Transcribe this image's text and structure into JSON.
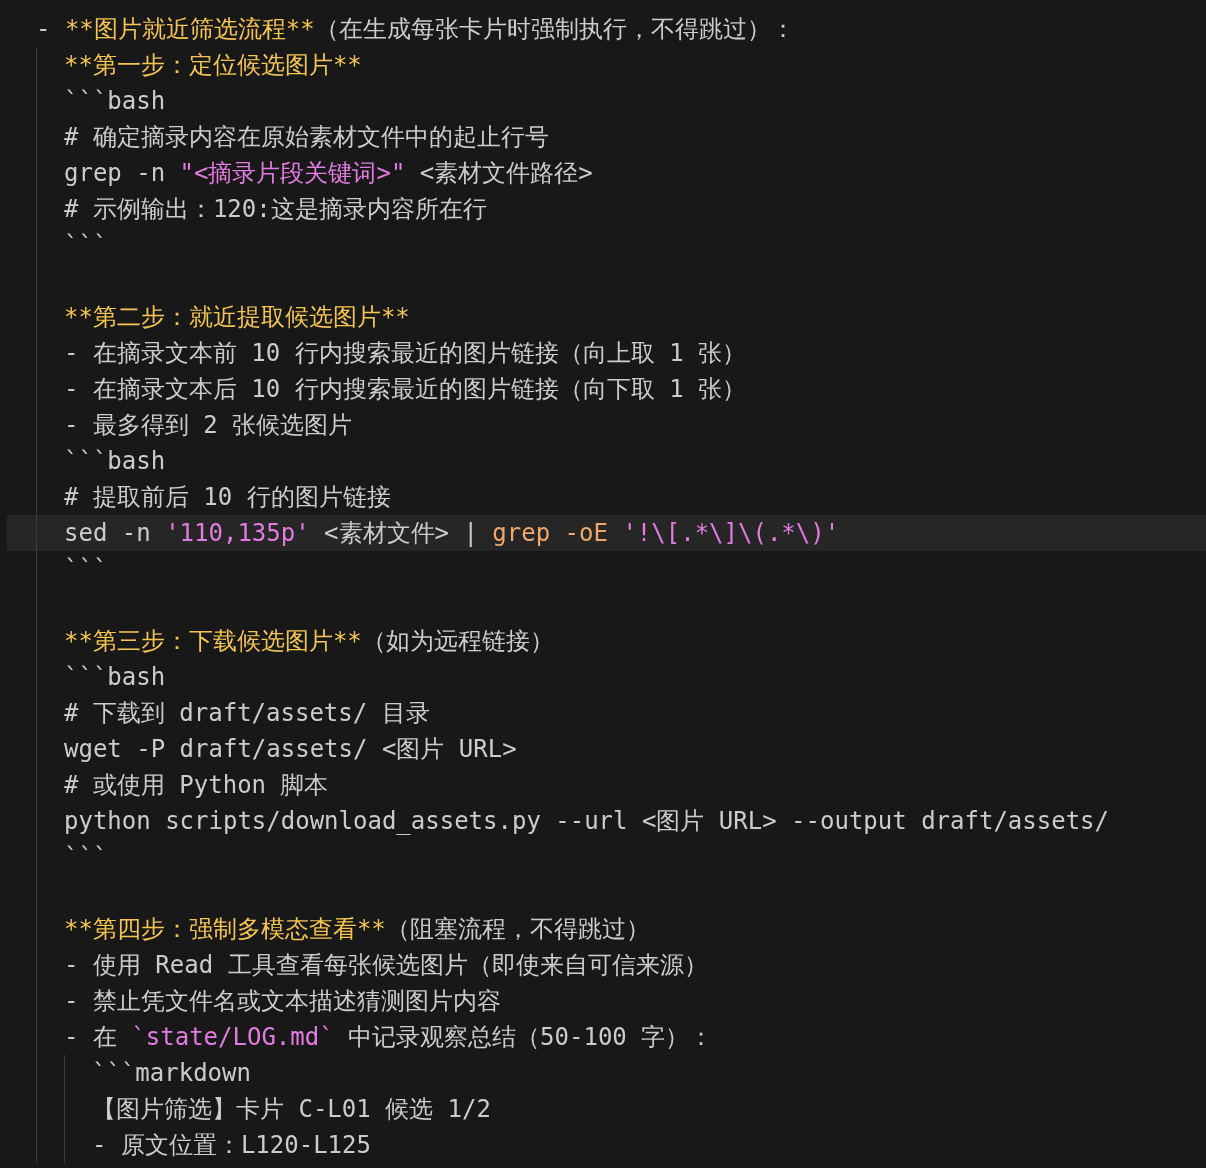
{
  "editor": {
    "lines": [
      {
        "kind": "code",
        "selected": false,
        "tokens": [
          {
            "kind": "text",
            "text": "- "
          },
          {
            "kind": "bold",
            "text": "**图片就近筛选流程**"
          },
          {
            "kind": "text",
            "text": "（在生成每张卡片时强制执行，不得跳过）："
          }
        ],
        "children": [
          {
            "kind": "code",
            "selected": false,
            "tokens": [
              {
                "kind": "bold",
                "text": "**第一步：定位候选图片**"
              }
            ]
          },
          {
            "kind": "code",
            "selected": false,
            "tokens": [
              {
                "kind": "text",
                "text": "```bash"
              }
            ]
          },
          {
            "kind": "code",
            "selected": false,
            "tokens": [
              {
                "kind": "text",
                "text": "# 确定摘录内容在原始素材文件中的起止行号"
              }
            ]
          },
          {
            "kind": "code",
            "selected": false,
            "tokens": [
              {
                "kind": "text",
                "text": "grep -n "
              },
              {
                "kind": "string",
                "text": "\"<摘录片段关键词>\""
              },
              {
                "kind": "text",
                "text": " <素材文件路径>"
              }
            ]
          },
          {
            "kind": "code",
            "selected": false,
            "tokens": [
              {
                "kind": "text",
                "text": "# 示例输出：120:这是摘录内容所在行"
              }
            ]
          },
          {
            "kind": "code",
            "selected": false,
            "tokens": [
              {
                "kind": "text",
                "text": "```"
              }
            ]
          },
          {
            "kind": "blank"
          },
          {
            "kind": "code",
            "selected": false,
            "tokens": [
              {
                "kind": "bold",
                "text": "**第二步：就近提取候选图片**"
              }
            ]
          },
          {
            "kind": "code",
            "selected": false,
            "tokens": [
              {
                "kind": "text",
                "text": "- 在摘录文本前 10 行内搜索最近的图片链接（向上取 1 张）"
              }
            ]
          },
          {
            "kind": "code",
            "selected": false,
            "tokens": [
              {
                "kind": "text",
                "text": "- 在摘录文本后 10 行内搜索最近的图片链接（向下取 1 张）"
              }
            ]
          },
          {
            "kind": "code",
            "selected": false,
            "tokens": [
              {
                "kind": "text",
                "text": "- 最多得到 2 张候选图片"
              }
            ]
          },
          {
            "kind": "code",
            "selected": false,
            "tokens": [
              {
                "kind": "text",
                "text": "```bash"
              }
            ]
          },
          {
            "kind": "code",
            "selected": false,
            "tokens": [
              {
                "kind": "text",
                "text": "# 提取前后 10 行的图片链接"
              }
            ]
          },
          {
            "kind": "code",
            "selected": true,
            "tokens": [
              {
                "kind": "text",
                "text": "sed -n "
              },
              {
                "kind": "string",
                "text": "'110,135p'"
              },
              {
                "kind": "text",
                "text": " <素材文件> | "
              },
              {
                "kind": "keyword",
                "text": "grep -oE "
              },
              {
                "kind": "string",
                "text": "'!\\[.*\\]\\(.*\\)'"
              }
            ]
          },
          {
            "kind": "code",
            "selected": false,
            "tokens": [
              {
                "kind": "text",
                "text": "```"
              }
            ]
          },
          {
            "kind": "blank"
          },
          {
            "kind": "code",
            "selected": false,
            "tokens": [
              {
                "kind": "bold",
                "text": "**第三步：下载候选图片**"
              },
              {
                "kind": "text",
                "text": "（如为远程链接）"
              }
            ]
          },
          {
            "kind": "code",
            "selected": false,
            "tokens": [
              {
                "kind": "text",
                "text": "```bash"
              }
            ]
          },
          {
            "kind": "code",
            "selected": false,
            "tokens": [
              {
                "kind": "text",
                "text": "# 下载到 draft/assets/ 目录"
              }
            ]
          },
          {
            "kind": "code",
            "selected": false,
            "tokens": [
              {
                "kind": "text",
                "text": "wget -P draft/assets/ <图片 URL>"
              }
            ]
          },
          {
            "kind": "code",
            "selected": false,
            "tokens": [
              {
                "kind": "text",
                "text": "# 或使用 Python 脚本"
              }
            ]
          },
          {
            "kind": "code",
            "selected": false,
            "tokens": [
              {
                "kind": "text",
                "text": "python scripts/download_assets.py --url <图片 URL> --output draft/assets/"
              }
            ]
          },
          {
            "kind": "code",
            "selected": false,
            "tokens": [
              {
                "kind": "text",
                "text": "```"
              }
            ]
          },
          {
            "kind": "blank"
          },
          {
            "kind": "code",
            "selected": false,
            "tokens": [
              {
                "kind": "bold",
                "text": "**第四步：强制多模态查看**"
              },
              {
                "kind": "text",
                "text": "（阻塞流程，不得跳过）"
              }
            ]
          },
          {
            "kind": "code",
            "selected": false,
            "tokens": [
              {
                "kind": "text",
                "text": "- 使用 Read 工具查看每张候选图片（即使来自可信来源）"
              }
            ]
          },
          {
            "kind": "code",
            "selected": false,
            "tokens": [
              {
                "kind": "text",
                "text": "- 禁止凭文件名或文本描述猜测图片内容"
              }
            ]
          },
          {
            "kind": "code",
            "selected": false,
            "tokens": [
              {
                "kind": "text",
                "text": "- 在 "
              },
              {
                "kind": "string",
                "text": "`state/LOG.md`"
              },
              {
                "kind": "text",
                "text": " 中记录观察总结（50-100 字）："
              }
            ],
            "children": [
              {
                "kind": "code",
                "selected": false,
                "tokens": [
                  {
                    "kind": "text",
                    "text": "```markdown"
                  }
                ]
              },
              {
                "kind": "code",
                "selected": false,
                "tokens": [
                  {
                    "kind": "text",
                    "text": "【图片筛选】卡片 C-L01 候选 1/2"
                  }
                ]
              },
              {
                "kind": "code",
                "selected": false,
                "tokens": [
                  {
                    "kind": "text",
                    "text": "- 原文位置：L120-L125"
                  }
                ]
              }
            ]
          }
        ]
      }
    ]
  }
}
